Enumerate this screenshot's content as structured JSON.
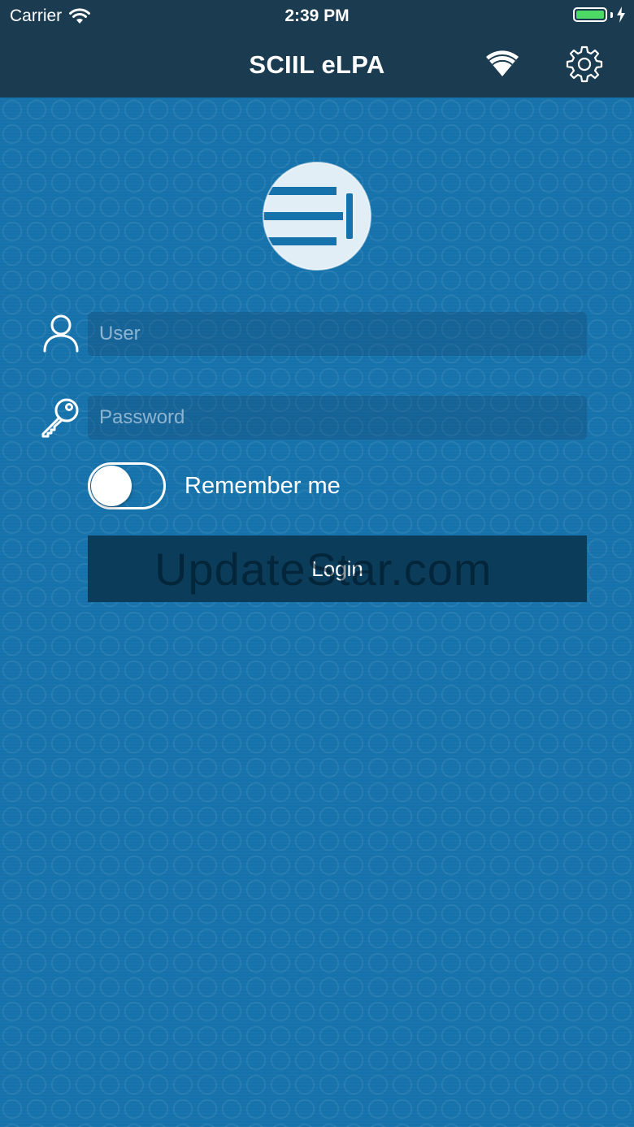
{
  "status_bar": {
    "carrier": "Carrier",
    "time": "2:39 PM",
    "wifi_icon": "wifi-icon",
    "battery_icon": "battery-charging-icon",
    "battery_color": "#4cd964"
  },
  "nav": {
    "title": "SCIIL eLPA",
    "connection_icon": "wifi-icon",
    "settings_icon": "gear-icon",
    "background": "#1b3b51"
  },
  "login_form": {
    "user_icon": "user-icon",
    "user_placeholder": "User",
    "user_value": "",
    "password_icon": "key-icon",
    "password_placeholder": "Password",
    "password_value": "",
    "remember_label": "Remember me",
    "remember_on": false,
    "login_label": "Login"
  },
  "watermark": "UpdateStar.com",
  "colors": {
    "background": "#1572ab",
    "button": "#0b3d5a"
  }
}
